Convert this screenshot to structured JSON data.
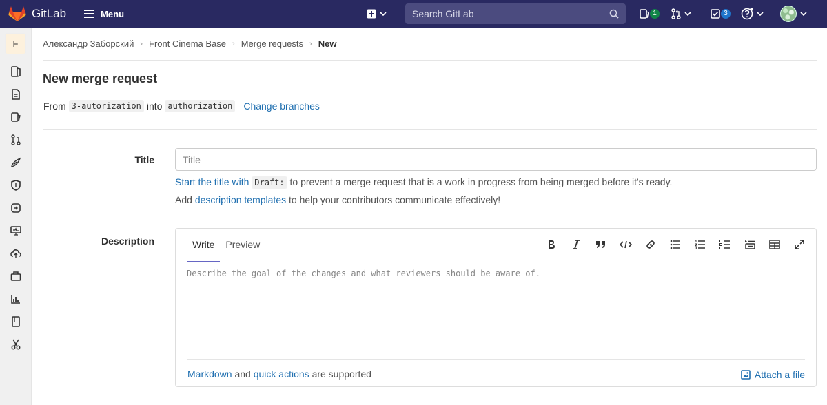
{
  "navbar": {
    "brand": "GitLab",
    "menu_label": "Menu",
    "search_placeholder": "Search GitLab",
    "issues_count": "1",
    "todos_count": "3"
  },
  "sidebar": {
    "project_initial": "F",
    "items": [
      {
        "icon": "project-overview-icon"
      },
      {
        "icon": "repository-icon"
      },
      {
        "icon": "issues-icon"
      },
      {
        "icon": "merge-requests-icon"
      },
      {
        "icon": "ci-cd-icon"
      },
      {
        "icon": "security-icon"
      },
      {
        "icon": "deployments-icon"
      },
      {
        "icon": "monitor-icon"
      },
      {
        "icon": "infrastructure-icon"
      },
      {
        "icon": "packages-icon"
      },
      {
        "icon": "analytics-icon"
      },
      {
        "icon": "wiki-icon"
      },
      {
        "icon": "snippets-icon"
      }
    ]
  },
  "breadcrumbs": [
    "Александр Заборский",
    "Front Cinema Base",
    "Merge requests",
    "New"
  ],
  "page": {
    "title": "New merge request",
    "from_label": "From",
    "source_branch": "3-autorization",
    "into_label": "into",
    "target_branch": "authorization",
    "change_branches": "Change branches"
  },
  "form": {
    "title_label": "Title",
    "title_placeholder": "Title",
    "draft_hint_link": "Start the title with",
    "draft_code": "Draft:",
    "draft_hint_rest": "to prevent a merge request that is a work in progress from being merged before it's ready.",
    "templates_prefix": "Add",
    "templates_link": "description templates",
    "templates_suffix": "to help your contributors communicate effectively!",
    "description_label": "Description",
    "tab_write": "Write",
    "tab_preview": "Preview",
    "description_placeholder": "Describe the goal of the changes and what reviewers should be aware of.",
    "markdown_link": "Markdown",
    "and_text": "and",
    "quick_actions_link": "quick actions",
    "supported_text": "are supported",
    "attach_file": "Attach a file"
  },
  "colors": {
    "navbar": "#292961",
    "link": "#1f6fb0",
    "active_tab": "#6666c4"
  }
}
